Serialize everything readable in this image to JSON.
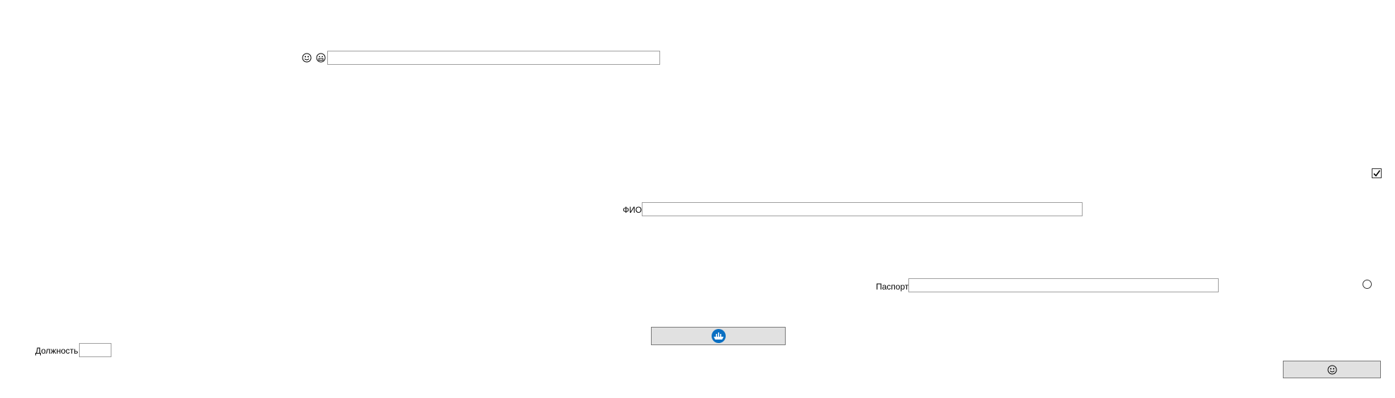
{
  "form": {
    "fio_label": "ФИО",
    "fio_value": "",
    "passport_label": "Паспорт",
    "passport_value": "",
    "position_label": "Должность",
    "position_value": "",
    "top_value": ""
  },
  "controls": {
    "checkbox_checked": true,
    "radio_selected": false
  },
  "icons": {
    "top_left": "smiley-face-icon",
    "top_right": "grinning-face-icon",
    "center_button": "ship-logo-icon",
    "bottom_button": "smiley-face-icon"
  },
  "colors": {
    "button_bg": "#e1e1e1",
    "button_border": "#7a7a7a",
    "field_border": "#a0a0a0",
    "ship_icon": "#0a6fc2"
  }
}
